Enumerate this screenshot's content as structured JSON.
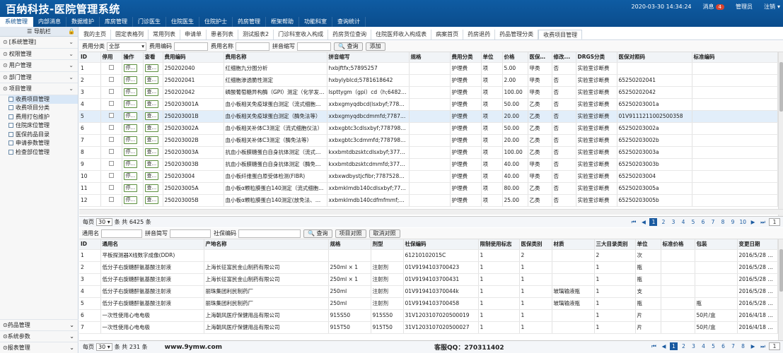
{
  "app": {
    "title": "百纳科技-医院管理系统"
  },
  "header": {
    "datetime": "2020-03-30 14:34:24",
    "messages_label": "消息",
    "messages_count": "4",
    "admin_label": "管理员",
    "logout_label": "注销"
  },
  "main_nav": [
    "系统管理",
    "内部消息",
    "数据维护",
    "库房管理",
    "门诊医生",
    "住院医生",
    "住院护士",
    "药房管理",
    "框架帮助",
    "功能科室",
    "查询统计"
  ],
  "sidebar": {
    "title": "导航栏",
    "menus": [
      {
        "label": "[系统管理]",
        "icon": "circle-icon"
      },
      {
        "label": "权限管理",
        "icon": "circle-icon"
      },
      {
        "label": "用户管理",
        "icon": "circle-icon"
      },
      {
        "label": "部门管理",
        "icon": "circle-icon"
      },
      {
        "label": "项目管理",
        "icon": "circle-icon"
      }
    ],
    "subitems": [
      "收费项目管理",
      "收费项目分类",
      "费用打包维护",
      "住院床位管理",
      "医保药品目录",
      "申请参数管理",
      "检查部位管理"
    ],
    "bottom": [
      "药品管理",
      "系统参数",
      "报表管理"
    ]
  },
  "tabs": [
    "我的主页",
    "固定表格列",
    "常用列表",
    "申请单",
    "患者列表",
    "测试报表2",
    "门诊科室收入构成",
    "药房货位查询",
    "住院医师收入构成表",
    "病案首页",
    "药房退药",
    "药品管理分类",
    "收费项目管理"
  ],
  "filter1": {
    "category_label": "费用分类",
    "category_value": "全部",
    "code_label": "费用编码",
    "name_label": "费用名称",
    "pinyin_label": "拼音缩写",
    "query": "查询",
    "add": "添加"
  },
  "grid1": {
    "columns": [
      "ID",
      "停用",
      "操作",
      "查看",
      "费用编码",
      "费用名称",
      "拼音缩写",
      "规格",
      "费用分类",
      "单位",
      "价格",
      "医保类别",
      "修改...",
      "DRGS分类",
      "医保对照码",
      "标准编码"
    ],
    "op_label": "停...",
    "view_label": "查...",
    "rows": [
      [
        "1",
        "250202040",
        "红细胞九分图分析",
        "hxbjftfx;57895257",
        "护理费",
        "项",
        "5.00",
        "甲类",
        "否",
        "实验室诊断费",
        ""
      ],
      [
        "2",
        "250202041",
        "红细胞渗透脆性测定",
        "hxbylyblcd;5781618642",
        "护理费",
        "项",
        "2.00",
        "甲类",
        "否",
        "实验室诊断费",
        "65250202041"
      ],
      [
        "3",
        "250202042",
        "磷酸葡萄糖异构酶（GPI）测定（化学发光...",
        "lspttygm（gpi）cd（h;6482218...",
        "护理费",
        "项",
        "100.00",
        "甲类",
        "否",
        "实验室诊断费",
        "65250202042"
      ],
      [
        "4",
        "250203001A",
        "血小板相关免疫球蛋白测定（流式细胞仪法）",
        "xxbxgmyqdbcd(lsxbyf;7787911...",
        "护理费",
        "项",
        "50.00",
        "乙类",
        "否",
        "实验室诊断费",
        "65250203001a"
      ],
      [
        "5",
        "250203001B",
        "血小板相关免疫球蛋白测定（酶免法等）",
        "xxbxgmyqdbcdmmfd;778791...",
        "护理费",
        "项",
        "20.00",
        "乙类",
        "否",
        "实验室诊断费",
        "01V9111211002500358"
      ],
      [
        "6",
        "250203002A",
        "血小板相关补体C3测定（流式细胞仪法）",
        "xxbxgbtc3cdlsxbyf;77879824...",
        "护理费",
        "项",
        "50.00",
        "乙类",
        "否",
        "实验室诊断费",
        "65250203002a"
      ],
      [
        "7",
        "250203002B",
        "血小板相关补体C3测定（酶免法等）",
        "xxbxgbtc3cdmmfd;77879824...",
        "护理费",
        "项",
        "20.00",
        "乙类",
        "否",
        "实验室诊断费",
        "65250203002b"
      ],
      [
        "8",
        "250203003A",
        "抗血小板膜糖蛋白自身抗体测定（流式细胞...",
        "kxxbmtdbzsktcdlsxbyf;377812...",
        "护理费",
        "项",
        "100.00",
        "乙类",
        "否",
        "实验室诊断费",
        "65250203003a"
      ],
      [
        "9",
        "250203003B",
        "抗血小板膜糖蛋白自身抗体测定（酶免法等）",
        "kxxbmtdbzsktcdmmfd;37781...",
        "护理费",
        "项",
        "40.00",
        "甲类",
        "否",
        "实验室诊断费",
        "65250203003b"
      ],
      [
        "10",
        "250203004",
        "血小板纤维蛋白原受体检测(FIBR)",
        "xxbxwdbystjcfibr;778752814...",
        "护理费",
        "项",
        "40.00",
        "甲类",
        "否",
        "实验室诊断费",
        "65250203004"
      ],
      [
        "11",
        "250203005A",
        "血小板α颗粒膜蛋白140测定（流式细胞...",
        "xxbmklmdb140cdlsxbyf;77781...",
        "护理费",
        "项",
        "80.00",
        "乙类",
        "否",
        "实验室诊断费",
        "65250203005a"
      ],
      [
        "12",
        "250203005B",
        "血小板α颗粒膜蛋白140测定(放免法、酶...",
        "xxbmklmdb140cdfmfmmf;778...",
        "护理费",
        "项",
        "25.00",
        "乙类",
        "否",
        "实验室诊断费",
        "65250203005b"
      ]
    ]
  },
  "pager1": {
    "per_page_label": "每页",
    "per_page": "30",
    "total": "条 共 6425 条",
    "pages": [
      "1",
      "2",
      "3",
      "4",
      "5",
      "6",
      "7",
      "8",
      "9",
      "10"
    ],
    "current": "1",
    "page_input": "1"
  },
  "filter2": {
    "generic_label": "通用名",
    "pinyin_label": "拼音简写",
    "insurance_label": "社保编码",
    "query": "查询",
    "compare": "项目对照",
    "cancel_compare": "取消对照"
  },
  "grid2": {
    "columns": [
      "ID",
      "通用名",
      "产地名称",
      "规格",
      "剂型",
      "社保编码",
      "限制使用标志",
      "医保类别",
      "材质",
      "三大目录类别",
      "单位",
      "标准价格",
      "包装",
      "变更日期"
    ],
    "rows": [
      [
        "1",
        "平板探测器X线数字成像(DDR)",
        "",
        "",
        "",
        "61210102015C",
        "1",
        "2",
        "",
        "2",
        "次",
        "",
        "",
        "2016/5/28 0:..."
      ],
      [
        "2",
        "低分子右旋糖酐氨基酸注射液",
        "上海长征富民金山制药有限公司",
        "250ml × 1",
        "注射剂",
        "01V9194103700423",
        "1",
        "1",
        "",
        "1",
        "瓶",
        "",
        "",
        "2016/5/28 0:..."
      ],
      [
        "3",
        "低分子右旋糖酐氨基酸注射液",
        "上海长征富民金山制药有限公司",
        "250ml × 1",
        "注射剂",
        "01V9194103700431",
        "1",
        "1",
        "",
        "1",
        "瓶",
        "",
        "",
        "2016/5/28 0:..."
      ],
      [
        "4",
        "低分子右旋糖酐氨基酸注射液",
        "丽珠集团利民制药厂",
        "250ml",
        "注射剂",
        "01V919410370044k",
        "1",
        "1",
        "玻璃输液瓶",
        "1",
        "支",
        "",
        "",
        "2016/5/28 0:..."
      ],
      [
        "5",
        "低分子右旋糖酐氨基酸注射液",
        "丽珠集团利民制药厂",
        "250ml",
        "注射剂",
        "01V9194103700458",
        "1",
        "1",
        "玻璃输液瓶",
        "1",
        "瓶",
        "",
        "瓶",
        "2016/5/28 0:..."
      ],
      [
        "6",
        "一次性使用心电电极",
        "上海朝风医疗保健用品有限公司",
        "915S50",
        "915S50",
        "31V1203107020500019",
        "1",
        "1",
        "",
        "1",
        "片",
        "",
        "50片/盒",
        "2016/4/18 0:..."
      ],
      [
        "7",
        "一次性使用心电电极",
        "上海朝风医疗保健用品有限公司",
        "915T50",
        "915T50",
        "31V1203107020500027",
        "1",
        "1",
        "",
        "1",
        "片",
        "",
        "50片/盒",
        "2016/4/18 0:..."
      ]
    ]
  },
  "pager2": {
    "per_page_label": "每页",
    "per_page": "30",
    "total": "条 共 231 条",
    "website": "www.9ymw.com",
    "qq": "客服QQ：270311402",
    "pages": [
      "1",
      "2",
      "3",
      "4",
      "5",
      "6",
      "7",
      "8"
    ],
    "current": "1",
    "page_input": "1"
  }
}
